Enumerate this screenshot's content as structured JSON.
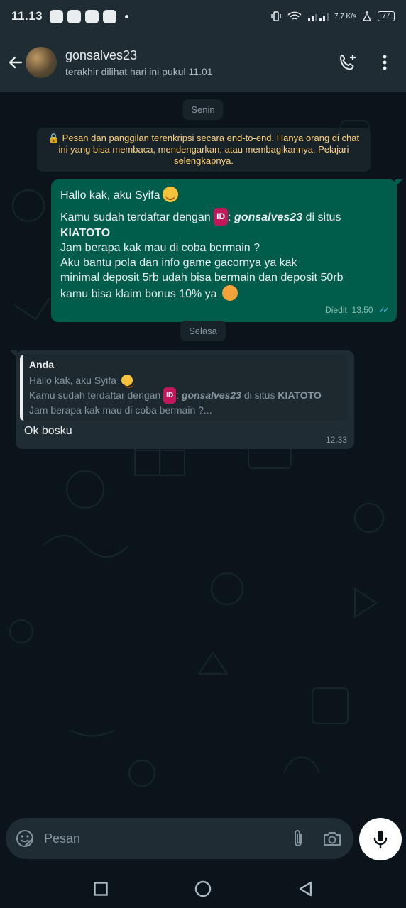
{
  "status_bar": {
    "time": "11.13",
    "network_speed": "7,7 K/s",
    "battery": "77"
  },
  "header": {
    "contact_name": "gonsalves23",
    "last_seen": "terakhir dilihat hari ini pukul 11.01"
  },
  "chat": {
    "day_1": "Senin",
    "encryption_notice": "🔒 Pesan dan panggilan terenkripsi secara end-to-end. Hanya orang di chat ini yang bisa membaca, mendengarkan, atau membagikannya. Pelajari selengkapnya.",
    "outgoing": {
      "greeting": "Hallo kak, aku Syifa",
      "registered_prefix": "Kamu sudah terdaftar dengan",
      "id_badge": "ID",
      "username": "gonsalves23",
      "site_suffix": "di situs",
      "site": "KIATOTO",
      "line_3": "Jam berapa kak mau di coba bermain ?",
      "line_4": "Aku bantu pola dan info game gacornya ya kak",
      "line_5": "minimal deposit 5rb udah bisa bermain dan deposit 50rb",
      "line_6": "kamu bisa klaim bonus 10% ya",
      "edited_label": "Diedit",
      "time": "13.50"
    },
    "day_2": "Selasa",
    "incoming": {
      "quote_author": "Anda",
      "quote_line_1": "Hallo kak, aku Syifa",
      "quote_line_2_prefix": "Kamu sudah terdaftar dengan",
      "quote_id": "ID",
      "quote_username": "gonsalves23",
      "quote_site_prefix": "di situs",
      "quote_site": "KIATOTO",
      "quote_line_3": "Jam berapa kak mau di coba bermain ?...",
      "text": "Ok bosku",
      "time": "12.33"
    }
  },
  "composer": {
    "placeholder": "Pesan"
  },
  "colors": {
    "outgoing_bubble": "#005c4b",
    "incoming_bubble": "#202c33",
    "background": "#0b141a",
    "read_ticks": "#53bdeb",
    "notice_text": "#ffd279"
  }
}
